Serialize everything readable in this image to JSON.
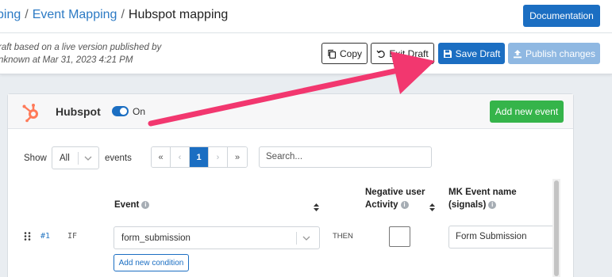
{
  "breadcrumb": {
    "part1": "ping",
    "sep": "/",
    "part2": "Event Mapping",
    "current": "Hubspot mapping"
  },
  "header": {
    "documentation_label": "Documentation"
  },
  "draft": {
    "info_line1": "raft based on a live version published by",
    "info_line2": "nknown at Mar 31, 2023 4:21 PM",
    "copy_label": "Copy",
    "exit_label": "Exit Draft",
    "save_label": "Save Draft",
    "publish_label": "Publish changes"
  },
  "integration": {
    "name": "Hubspot",
    "toggle_label": "On",
    "enabled": true,
    "add_event_label": "Add new event"
  },
  "table_controls": {
    "show_label": "Show",
    "page_size": "All",
    "events_label": "events",
    "pager": [
      "«",
      "‹",
      "1",
      "›",
      "»"
    ],
    "current_page": "1",
    "search_placeholder": "Search..."
  },
  "columns": {
    "event": "Event",
    "negative_line1": "Negative user",
    "negative_line2": "Activity",
    "mk_line1": "MK Event name",
    "mk_line2": "(signals)"
  },
  "rows": [
    {
      "num": "#1",
      "condition": "IF",
      "event": "form_submission",
      "then": "THEN",
      "negative_checked": false,
      "mk_event_name": "Form Submission",
      "add_condition_label": "Add new condition"
    }
  ],
  "colors": {
    "primary": "#1b6ec2",
    "success": "#35b44a",
    "hubspot": "#ff7a59",
    "annotation_arrow": "#f2376f"
  }
}
